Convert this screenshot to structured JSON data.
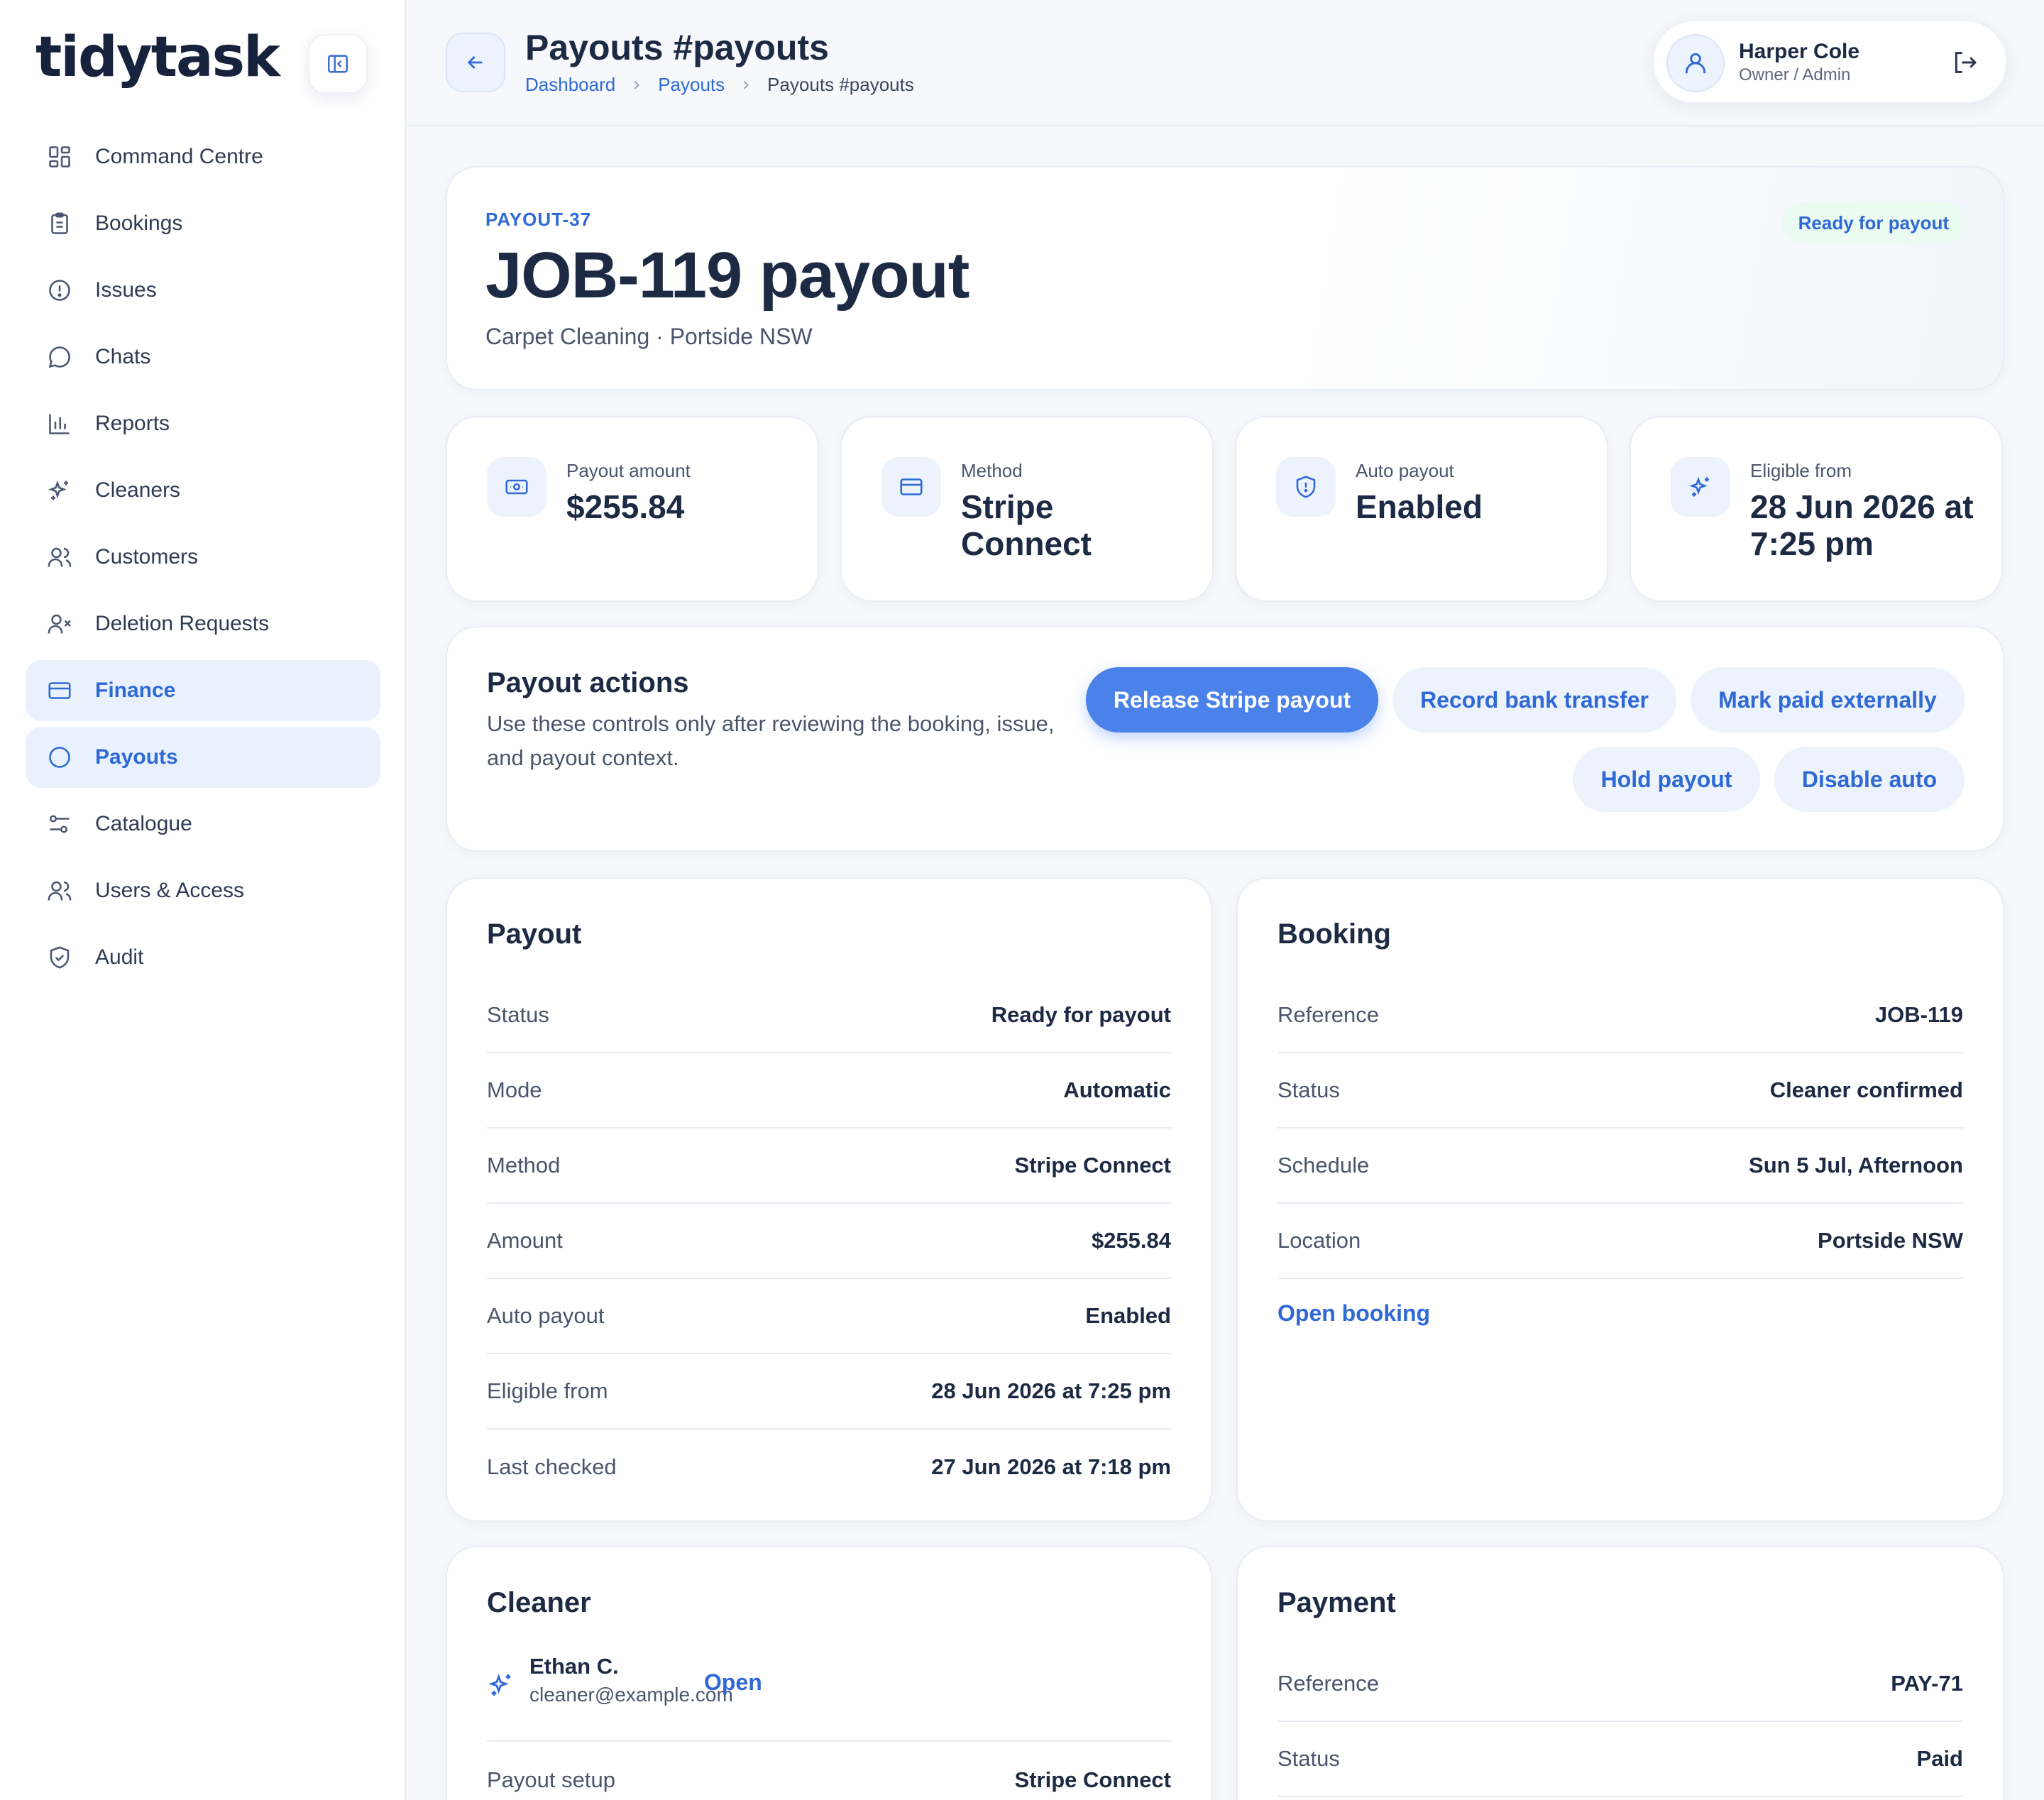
{
  "app": {
    "logo": "tidytask"
  },
  "sidebar": {
    "items": [
      {
        "label": "Command Centre",
        "icon": "grid-icon"
      },
      {
        "label": "Bookings",
        "icon": "clipboard-icon"
      },
      {
        "label": "Issues",
        "icon": "alert-circle-icon"
      },
      {
        "label": "Chats",
        "icon": "chat-bubble-icon"
      },
      {
        "label": "Reports",
        "icon": "bar-chart-icon"
      },
      {
        "label": "Cleaners",
        "icon": "sparkles-icon"
      },
      {
        "label": "Customers",
        "icon": "users-icon"
      },
      {
        "label": "Deletion Requests",
        "icon": "user-x-icon"
      },
      {
        "label": "Finance",
        "icon": "credit-card-icon",
        "active": true
      },
      {
        "label": "Payouts",
        "icon": "circle-icon",
        "active": true
      },
      {
        "label": "Catalogue",
        "icon": "sliders-icon"
      },
      {
        "label": "Users & Access",
        "icon": "users-icon"
      },
      {
        "label": "Audit",
        "icon": "shield-check-icon"
      }
    ]
  },
  "header": {
    "title": "Payouts #payouts",
    "breadcrumbs": [
      "Dashboard",
      "Payouts",
      "Payouts #payouts"
    ]
  },
  "user": {
    "name": "Harper Cole",
    "role": "Owner / Admin"
  },
  "hero": {
    "eyebrow": "PAYOUT-37",
    "title": "JOB-119 payout",
    "subtitle": "Carpet Cleaning · Portside NSW",
    "badge": "Ready for payout"
  },
  "stats": [
    {
      "label": "Payout amount",
      "value": "$255.84",
      "icon": "cash-icon"
    },
    {
      "label": "Method",
      "value": "Stripe Connect",
      "icon": "credit-card-icon"
    },
    {
      "label": "Auto payout",
      "value": "Enabled",
      "icon": "shield-alert-icon"
    },
    {
      "label": "Eligible from",
      "value": "28 Jun 2026 at 7:25 pm",
      "icon": "sparkles-icon"
    }
  ],
  "actions": {
    "title": "Payout actions",
    "description": "Use these controls only after reviewing the booking, issue, and payout context.",
    "buttons": {
      "release": "Release Stripe payout",
      "record": "Record bank transfer",
      "mark": "Mark paid externally",
      "hold": "Hold payout",
      "disable": "Disable auto"
    }
  },
  "payout": {
    "title": "Payout",
    "rows": [
      {
        "k": "Status",
        "v": "Ready for payout"
      },
      {
        "k": "Mode",
        "v": "Automatic"
      },
      {
        "k": "Method",
        "v": "Stripe Connect"
      },
      {
        "k": "Amount",
        "v": "$255.84"
      },
      {
        "k": "Auto payout",
        "v": "Enabled"
      },
      {
        "k": "Eligible from",
        "v": "28 Jun 2026 at 7:25 pm"
      },
      {
        "k": "Last checked",
        "v": "27 Jun 2026 at 7:18 pm"
      }
    ]
  },
  "booking": {
    "title": "Booking",
    "rows": [
      {
        "k": "Reference",
        "v": "JOB-119"
      },
      {
        "k": "Status",
        "v": "Cleaner confirmed"
      },
      {
        "k": "Schedule",
        "v": "Sun 5 Jul, Afternoon"
      },
      {
        "k": "Location",
        "v": "Portside NSW"
      }
    ],
    "link": "Open booking"
  },
  "cleaner": {
    "title": "Cleaner",
    "name": "Ethan C.",
    "email": "cleaner@example.com",
    "open": "Open",
    "rows": [
      {
        "k": "Payout setup",
        "v": "Stripe Connect"
      }
    ]
  },
  "payment": {
    "title": "Payment",
    "rows": [
      {
        "k": "Reference",
        "v": "PAY-71"
      },
      {
        "k": "Status",
        "v": "Paid"
      }
    ]
  },
  "colors": {
    "accent": "#2f69d6",
    "primary_button": "#4a82ea",
    "text": "#1d2a44",
    "badge_bg": "#ecfbf1"
  }
}
